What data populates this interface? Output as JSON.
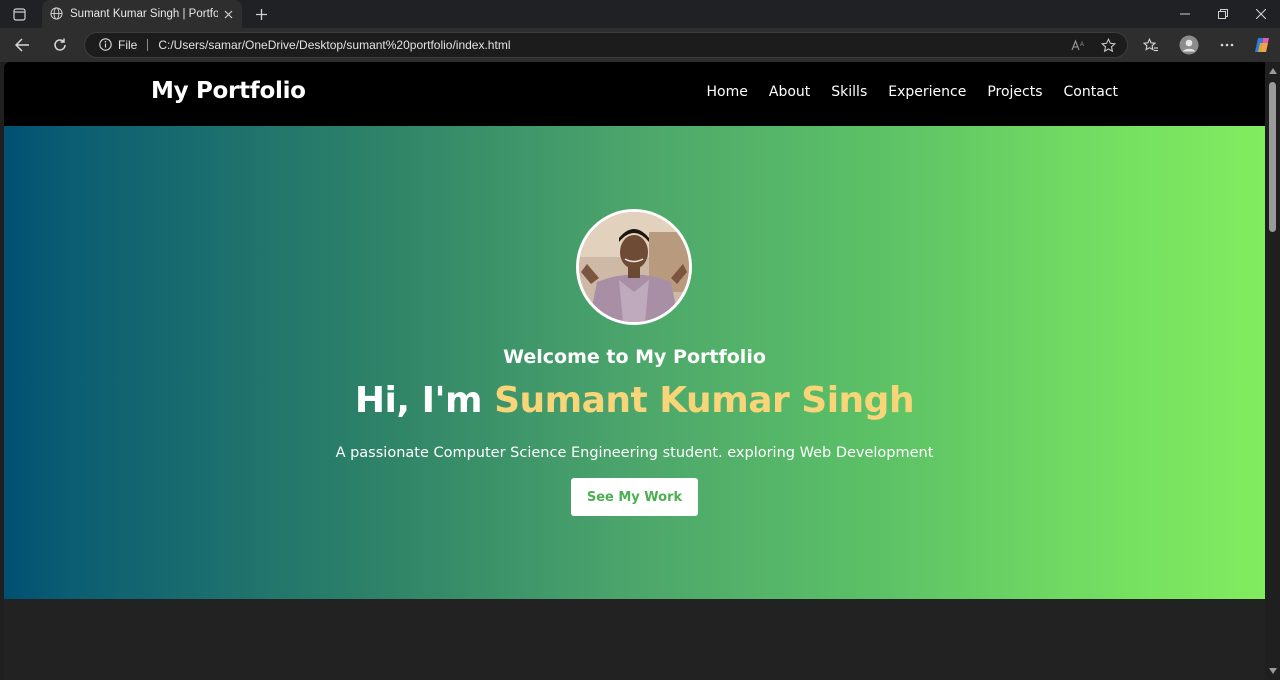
{
  "browser": {
    "tab_title": "Sumant Kumar Singh | Portfolio",
    "address_protocol": "File",
    "address_url": "C:/Users/samar/OneDrive/Desktop/sumant%20portfolio/index.html",
    "icons": [
      "tab-actions-icon",
      "globe-icon",
      "close-icon",
      "plus-icon",
      "minimize-icon",
      "restore-icon",
      "close-window-icon",
      "back-icon",
      "refresh-icon",
      "info-icon",
      "read-aloud-icon",
      "star-icon",
      "favorites-icon",
      "profile-icon",
      "more-icon",
      "copilot-icon"
    ]
  },
  "site": {
    "logo": "My Portfolio",
    "nav": [
      "Home",
      "About",
      "Skills",
      "Experience",
      "Projects",
      "Contact"
    ]
  },
  "hero": {
    "welcome": "Welcome to My Portfolio",
    "greeting": "Hi, I'm",
    "name": "Sumant Kumar Singh",
    "tagline": "A passionate Computer Science Engineering student. exploring Web Development",
    "cta": "See My Work"
  },
  "colors": {
    "header_bg": "#000000",
    "hero_gradient_start": "#005072",
    "hero_gradient_end": "#82ec5f",
    "name_accent": "#f9d57a",
    "cta_text": "#4caf50",
    "page_bg": "#222222"
  }
}
